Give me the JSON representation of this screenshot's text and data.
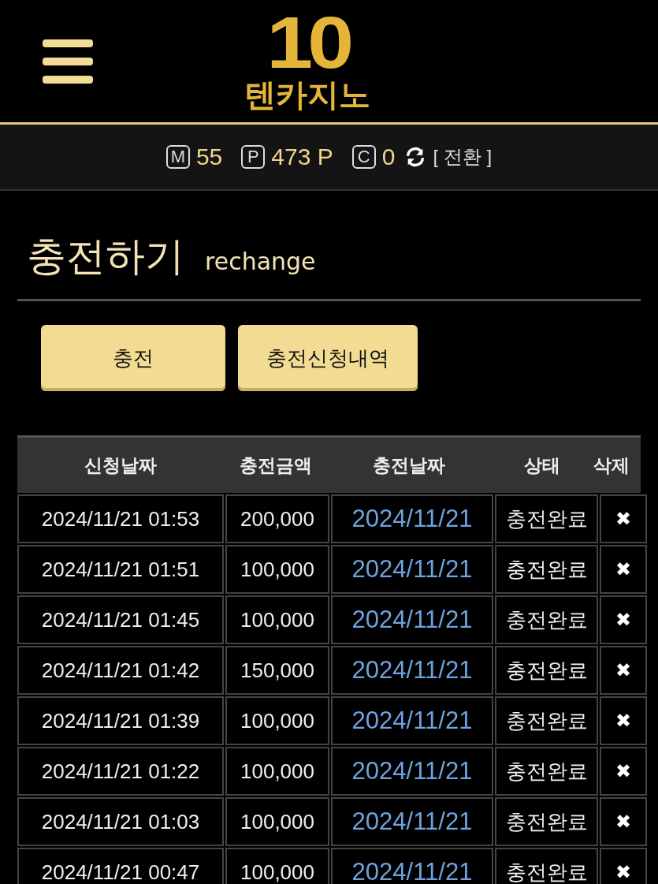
{
  "header": {
    "logo_number": "10",
    "logo_name": "텐카지노"
  },
  "balances": [
    {
      "badge": "M",
      "value": "55"
    },
    {
      "badge": "P",
      "value": "473 P"
    },
    {
      "badge": "C",
      "value": "0"
    }
  ],
  "switch_label": "[ 전환 ]",
  "page_title": "충전하기",
  "page_subtitle": "rechange",
  "buttons": [
    "충전",
    "충전신청내역"
  ],
  "table": {
    "columns": [
      "신청날짜",
      "충전금액",
      "충전날짜",
      "상태",
      "삭제"
    ],
    "rows": [
      {
        "requested": "2024/11/21 01:53",
        "amount": "200,000",
        "charged": "2024/11/21",
        "status": "충전완료",
        "delete": "✖"
      },
      {
        "requested": "2024/11/21 01:51",
        "amount": "100,000",
        "charged": "2024/11/21",
        "status": "충전완료",
        "delete": "✖"
      },
      {
        "requested": "2024/11/21 01:45",
        "amount": "100,000",
        "charged": "2024/11/21",
        "status": "충전완료",
        "delete": "✖"
      },
      {
        "requested": "2024/11/21 01:42",
        "amount": "150,000",
        "charged": "2024/11/21",
        "status": "충전완료",
        "delete": "✖"
      },
      {
        "requested": "2024/11/21 01:39",
        "amount": "100,000",
        "charged": "2024/11/21",
        "status": "충전완료",
        "delete": "✖"
      },
      {
        "requested": "2024/11/21 01:22",
        "amount": "100,000",
        "charged": "2024/11/21",
        "status": "충전완료",
        "delete": "✖"
      },
      {
        "requested": "2024/11/21 01:03",
        "amount": "100,000",
        "charged": "2024/11/21",
        "status": "충전완료",
        "delete": "✖"
      },
      {
        "requested": "2024/11/21 00:47",
        "amount": "100,000",
        "charged": "2024/11/21",
        "status": "충전완료",
        "delete": "✖"
      }
    ]
  }
}
